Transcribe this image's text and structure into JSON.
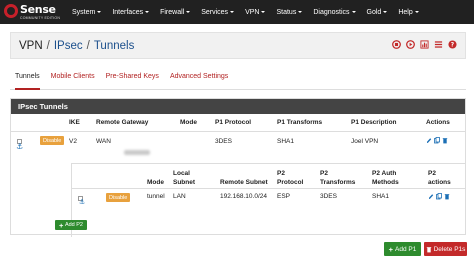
{
  "brand": {
    "name": "Sense",
    "subtitle": "COMMUNITY EDITION",
    "accent": "#c6202a"
  },
  "nav": {
    "items": [
      {
        "label": "System",
        "has_caret": true
      },
      {
        "label": "Interfaces",
        "has_caret": true
      },
      {
        "label": "Firewall",
        "has_caret": true
      },
      {
        "label": "Services",
        "has_caret": true
      },
      {
        "label": "VPN",
        "has_caret": true
      },
      {
        "label": "Status",
        "has_caret": true
      },
      {
        "label": "Diagnostics",
        "has_caret": true
      },
      {
        "label": "Gold",
        "has_caret": true
      },
      {
        "label": "Help",
        "has_caret": true
      }
    ]
  },
  "breadcrumb": {
    "parts": [
      "VPN",
      "IPsec",
      "Tunnels"
    ],
    "separator": "/",
    "tools": [
      "stop-circle-icon",
      "play-circle-icon",
      "bar-chart-icon",
      "list-icon",
      "help-circle-icon"
    ]
  },
  "tabs": [
    {
      "label": "Tunnels",
      "active": true
    },
    {
      "label": "Mobile Clients",
      "active": false
    },
    {
      "label": "Pre-Shared Keys",
      "active": false
    },
    {
      "label": "Advanced Settings",
      "active": false
    }
  ],
  "panel": {
    "title": "IPsec Tunnels",
    "p1_headers": {
      "ike": "IKE",
      "remote_gateway": "Remote Gateway",
      "mode": "Mode",
      "p1_protocol": "P1 Protocol",
      "p1_transforms": "P1 Transforms",
      "p1_description": "P1 Description",
      "actions": "Actions"
    },
    "p1_row": {
      "disable_label": "Disable",
      "ike": "V2",
      "remote_gateway": "WAN",
      "mode": "",
      "p1_protocol": "3DES",
      "p1_transforms": "SHA1",
      "p1_description": "Joel VPN"
    },
    "p2_headers": {
      "mode": "Mode",
      "local_subnet_1": "Local",
      "local_subnet_2": "Subnet",
      "remote_subnet": "Remote Subnet",
      "p2_protocol_1": "P2",
      "p2_protocol_2": "Protocol",
      "p2_transforms_1": "P2",
      "p2_transforms_2": "Transforms",
      "p2_auth_1": "P2 Auth",
      "p2_auth_2": "Methods",
      "p2_actions_1": "P2",
      "p2_actions_2": "actions"
    },
    "p2_row": {
      "disable_label": "Disable",
      "mode": "tunnel",
      "local_subnet": "LAN",
      "remote_subnet": "192.168.10.0/24",
      "p2_protocol": "ESP",
      "p2_transforms": "3DES",
      "p2_auth": "SHA1"
    },
    "add_p2_label": "Add P2"
  },
  "footer": {
    "add_p1_label": "Add P1",
    "delete_p1_label": "Delete P1s"
  },
  "colors": {
    "navbar": "#212121",
    "link": "#1b4f8c",
    "tab_active_underline": "#b22222",
    "panel_head": "#444444",
    "disable_button": "#e8a13d",
    "add_button": "#2e8b2e",
    "delete_button": "#c32a2a",
    "icon_blue": "#1b6fb5"
  }
}
